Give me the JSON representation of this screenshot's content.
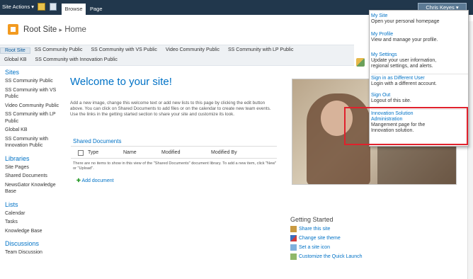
{
  "ribbon": {
    "site_actions": "Site Actions ▾",
    "tab_browse": "Browse",
    "tab_page": "Page",
    "user": "Chris Keyes ▾"
  },
  "header": {
    "site_title": "Root Site",
    "separator": "▸",
    "crumb": "Home"
  },
  "topnav": {
    "row1": [
      "Root Site",
      "SS Community Public",
      "SS Community with VS Public",
      "Video Community Public",
      "SS Community with LP Public"
    ],
    "row2": [
      "Global KB",
      "SS Community with Innovation Public"
    ]
  },
  "quick_launch": {
    "sites_heading": "Sites",
    "sites": [
      "SS Community Public",
      "SS Community with VS Public",
      "Video Community Public",
      "SS Community with LP Public",
      "Global KB",
      "SS Community with Innovation Public"
    ],
    "libraries_heading": "Libraries",
    "libraries": [
      "Site Pages",
      "Shared Documents",
      "NewsGator Knowledge Base"
    ],
    "lists_heading": "Lists",
    "lists": [
      "Calendar",
      "Tasks",
      "Knowledge Base"
    ],
    "discussions_heading": "Discussions",
    "discussions": [
      "Team Discussion"
    ]
  },
  "main": {
    "welcome": "Welcome to your site!",
    "intro": "Add a new image, change this welcome text or add new lists to this page by clicking the edit button above. You can click on Shared Documents to add files or on the calendar to create new team events. Use the links in the getting started section to share your site and customize its look.",
    "docs_title": "Shared Documents",
    "columns": [
      "Type",
      "Name",
      "Modified",
      "Modified By"
    ],
    "empty": "There are no items to show in this view of the \"Shared Documents\" document library. To add a new item, click \"New\" or \"Upload\".",
    "add_document": "Add document"
  },
  "getting_started": {
    "title": "Getting Started",
    "items": [
      "Share this site",
      "Change site theme",
      "Set a site icon",
      "Customize the Quick Launch"
    ]
  },
  "user_menu": [
    {
      "title": "My Site",
      "desc": "Open your personal homepage"
    },
    {
      "title": "My Profile",
      "desc": "View and manage your profile."
    },
    {
      "title": "My Settings",
      "desc": "Update your user information, regional settings, and alerts."
    },
    {
      "title": "Sign in as Different User",
      "desc": "Login with a different account."
    },
    {
      "title": "Sign Out",
      "desc": "Logout of this site."
    },
    {
      "title": "Innovation Solution Administration",
      "desc": "Mangement page for the Innovation solution."
    }
  ],
  "colors": {
    "ribbon": "#21374c",
    "link_blue": "#0072c6",
    "highlight": "#e0212c"
  }
}
